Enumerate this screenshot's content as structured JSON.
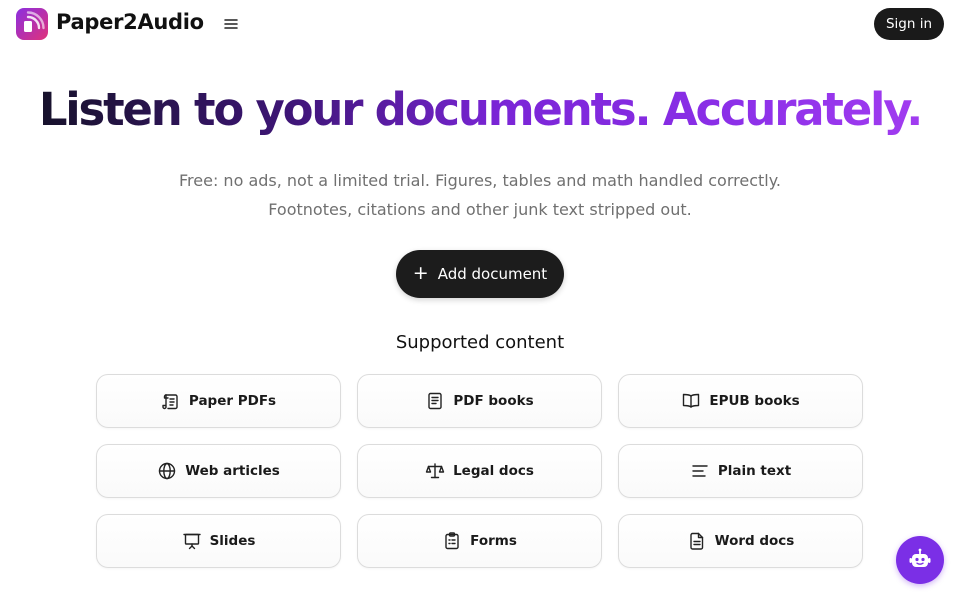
{
  "header": {
    "brand": "Paper2Audio",
    "menu_icon": "menu-icon",
    "sign_in": "Sign in"
  },
  "hero": {
    "title": "Listen to your documents. Accurately.",
    "subtitle_line1": "Free: no ads, not a limited trial. Figures, tables and math handled correctly.",
    "subtitle_line2": "Footnotes, citations and other junk text stripped out.",
    "add_button": "Add document",
    "add_icon": "+"
  },
  "supported": {
    "title": "Supported content",
    "items": [
      {
        "label": "Paper PDFs",
        "icon": "scroll-icon"
      },
      {
        "label": "PDF books",
        "icon": "book-icon"
      },
      {
        "label": "EPUB books",
        "icon": "open-book-icon"
      },
      {
        "label": "Web articles",
        "icon": "globe-icon"
      },
      {
        "label": "Legal docs",
        "icon": "scale-icon"
      },
      {
        "label": "Plain text",
        "icon": "text-lines-icon"
      },
      {
        "label": "Slides",
        "icon": "presentation-icon"
      },
      {
        "label": "Forms",
        "icon": "clipboard-icon"
      },
      {
        "label": "Word docs",
        "icon": "document-icon"
      }
    ]
  },
  "chat_bot": {
    "icon": "robot-icon"
  },
  "colors": {
    "accent": "#7b2fe6",
    "dark": "#1a1a1a",
    "logo_gradient_start": "#8b2fe0",
    "logo_gradient_end": "#e0327a",
    "muted_text": "#707070"
  }
}
